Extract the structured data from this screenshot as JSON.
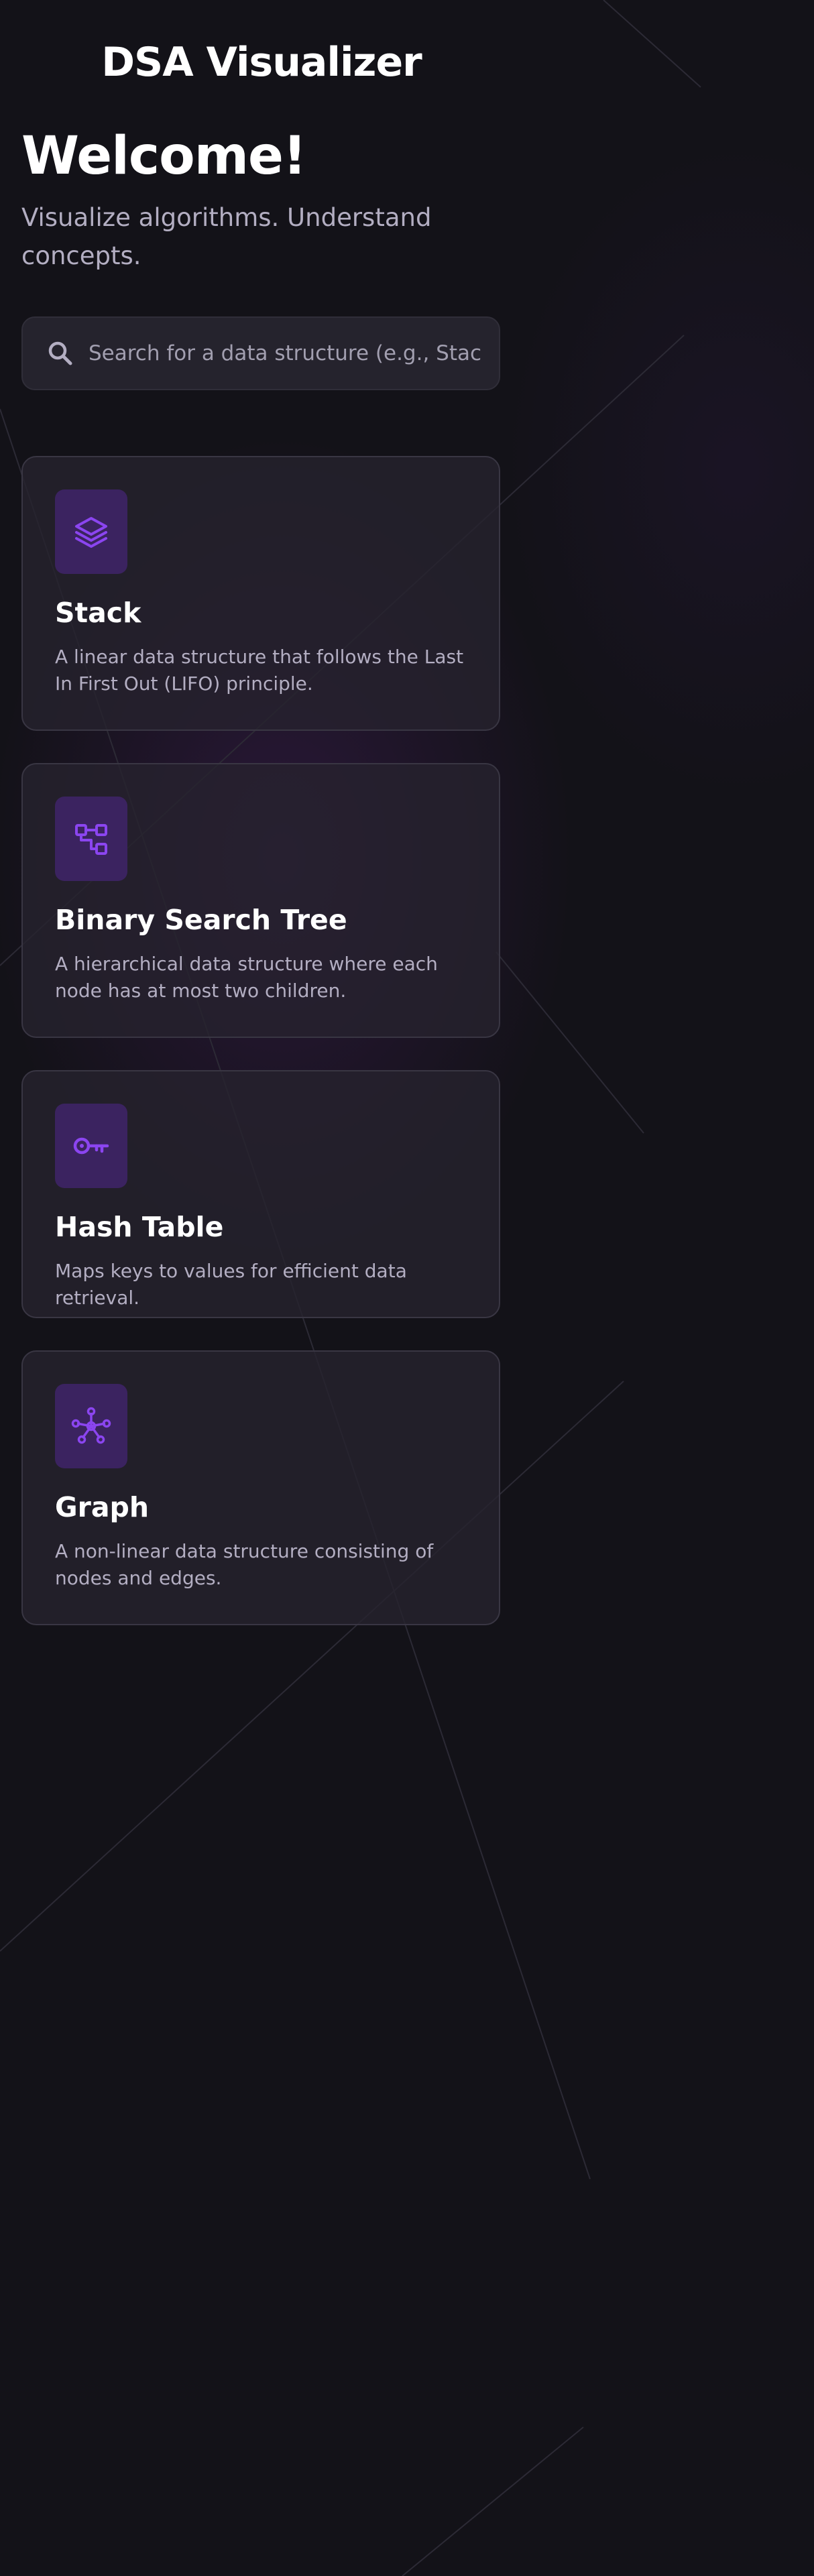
{
  "app": {
    "title": "DSA Visualizer"
  },
  "hero": {
    "heading": "Welcome!",
    "subtitle": "Visualize algorithms. Understand concepts."
  },
  "search": {
    "placeholder": "Search for a data structure (e.g., Stack)...",
    "value": "",
    "icon": "search-icon"
  },
  "theme": {
    "background": "#131218",
    "card_background": "#26232e",
    "card_border": "#393643",
    "accent": "#8b45f0",
    "icon_tile": "#3b2360",
    "muted_text": "#b3aec2"
  },
  "cards": [
    {
      "icon": "layers-icon",
      "title": "Stack",
      "description": "A linear data structure that follows the Last In First Out (LIFO) principle."
    },
    {
      "icon": "tree-structure-icon",
      "title": "Binary Search Tree",
      "description": "A hierarchical data structure where each node has at most two children."
    },
    {
      "icon": "key-icon",
      "title": "Hash Table",
      "description": "Maps keys to values for efficient data retrieval."
    },
    {
      "icon": "graph-nodes-icon",
      "title": "Graph",
      "description": "A non-linear data structure consisting of nodes and edges."
    }
  ]
}
